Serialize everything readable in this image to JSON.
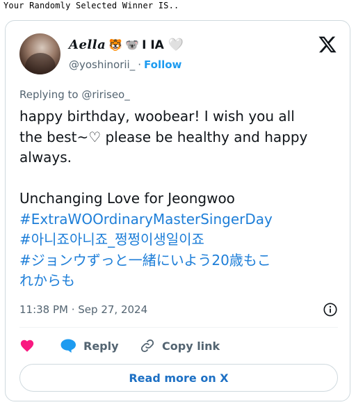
{
  "header": {
    "title": "Your Randomly Selected Winner IS.."
  },
  "tweet": {
    "author": {
      "display_name": "Aella",
      "emoji_1": "🐯",
      "emoji_2": "🐨",
      "suffix": "I IA",
      "heart": "🤍",
      "handle": "@yoshinorii_",
      "separator": "·",
      "follow_label": "Follow",
      "avatar": "avatar-photo"
    },
    "reply_to": "Replying to @ririseo_",
    "text_lines": [
      "happy birthday, woobear! I wish you all",
      "the best~♡ please be healthy and happy",
      "always."
    ],
    "second_para": "Unchanging Love for Jeongwoo",
    "hashtags": [
      "#ExtraWOOrdinaryMasterSingerDay",
      "#아니죠아니죠_쩡쩡이생일이죠",
      "#ジョンウずっと一緒にいよう20歳もこ",
      "れからも"
    ],
    "timestamp": "11:38 PM · Sep 27, 2024",
    "actions": {
      "like_icon": "heart-icon",
      "reply_label": "Reply",
      "copy_label": "Copy link"
    },
    "read_more_label": "Read more on X"
  },
  "colors": {
    "link": "#1d7ed8",
    "like": "#f91880",
    "reply": "#1d9bf0",
    "muted": "#536471",
    "border": "#cfd9de"
  }
}
